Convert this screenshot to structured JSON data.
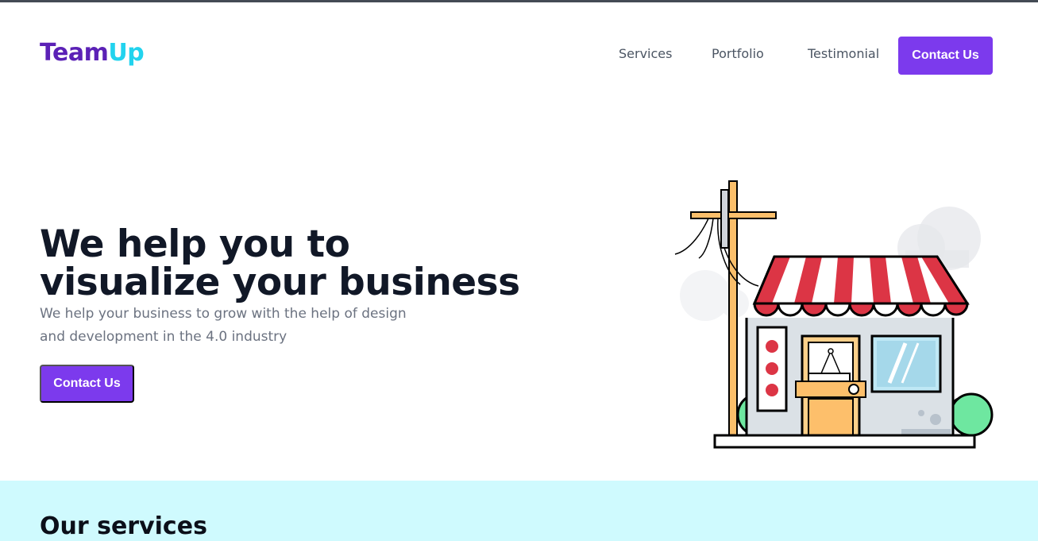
{
  "brand": {
    "part1": "Team",
    "part2": "Up",
    "color1": "#5b21b6",
    "color2": "#22d3ee"
  },
  "nav": {
    "items": [
      {
        "label": "Services"
      },
      {
        "label": "Portfolio"
      },
      {
        "label": "Testimonial"
      }
    ],
    "cta_label": "Contact Us"
  },
  "hero": {
    "title_line1": "We help you to",
    "title_line2": "visualize your business",
    "subtitle": "We help your business to grow with the help of design and development in the 4.0 industry",
    "cta_label": "Contact Us",
    "illustration_icon": "storefront-illustration"
  },
  "services": {
    "heading": "Our services"
  },
  "colors": {
    "accent": "#7c3aed",
    "services_bg": "#cffafe",
    "text_dark": "#111827",
    "text_muted": "#6b7280"
  }
}
